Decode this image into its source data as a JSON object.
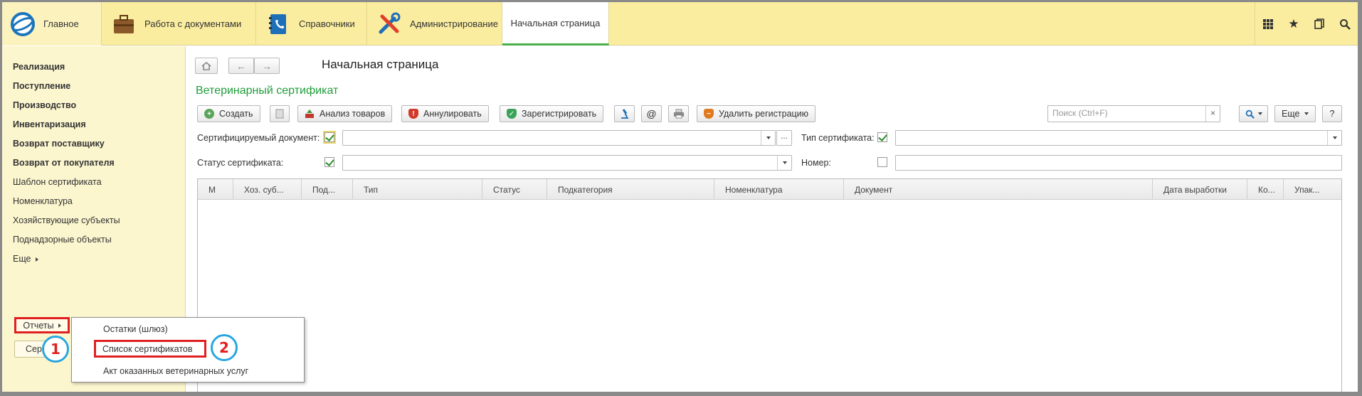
{
  "topbar": {
    "sections": [
      {
        "label": "Главное",
        "icon": "app-logo-icon"
      },
      {
        "label": "Работа с документами",
        "icon": "briefcase-icon"
      },
      {
        "label": "Справочники",
        "icon": "phonebook-icon"
      },
      {
        "label": "Администрирование",
        "icon": "tools-icon"
      }
    ],
    "active_tab": "Начальная страница",
    "right_icons": [
      "grid-icon",
      "star-icon",
      "history-icon",
      "search-icon"
    ]
  },
  "sidebar": {
    "items": [
      {
        "label": "Реализация",
        "bold": true
      },
      {
        "label": "Поступление",
        "bold": true
      },
      {
        "label": "Производство",
        "bold": true
      },
      {
        "label": "Инвентаризация",
        "bold": true
      },
      {
        "label": "Возврат поставщику",
        "bold": true
      },
      {
        "label": "Возврат от покупателя",
        "bold": true
      },
      {
        "label": "Шаблон сертификата",
        "bold": false
      },
      {
        "label": "Номенклатура",
        "bold": false
      },
      {
        "label": "Хозяйствующие субъекты",
        "bold": false
      },
      {
        "label": "Поднадзорные объекты",
        "bold": false
      },
      {
        "label": "Еще",
        "bold": false
      }
    ],
    "reports_label": "Отчеты",
    "cert_button_label": "Сер"
  },
  "popup": {
    "items": [
      "Остатки (шлюз)",
      "Список сертификатов",
      "Акт оказанных ветеринарных услуг"
    ]
  },
  "badges": [
    "1",
    "2"
  ],
  "main": {
    "page_title": "Начальная страница",
    "form_title": "Ветеринарный сертификат",
    "toolbar": {
      "create": "Создать",
      "analysis": "Анализ товаров",
      "cancel": "Аннулировать",
      "register": "Зарегистрировать",
      "at": "@",
      "delete_registration": "Удалить регистрацию",
      "search_placeholder": "Поиск (Ctrl+F)",
      "more": "Еще",
      "help": "?"
    },
    "filters": {
      "certified_doc_label": "Сертифицируемый документ:",
      "cert_type_label": "Тип сертификата:",
      "cert_status_label": "Статус сертификата:",
      "number_label": "Номер:"
    },
    "columns": [
      "М",
      "Хоз. суб...",
      "Под...",
      "Тип",
      "Статус",
      "Подкатегория",
      "Номенклатура",
      "Документ",
      "Дата выработки",
      "Ко...",
      "Упак..."
    ]
  }
}
